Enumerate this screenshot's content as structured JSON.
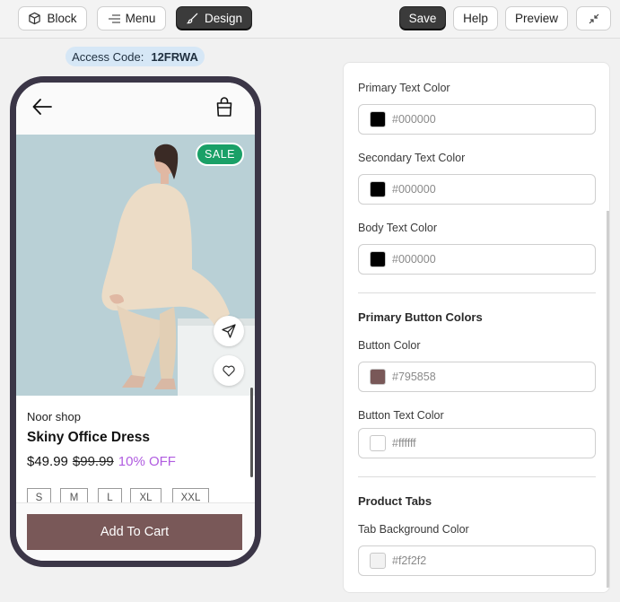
{
  "toolbar": {
    "block": "Block",
    "menu": "Menu",
    "design": "Design",
    "save": "Save",
    "help": "Help",
    "preview": "Preview"
  },
  "access": {
    "label": "Access Code:",
    "code": "12FRWA"
  },
  "product": {
    "badge": "SALE",
    "shop": "Noor shop",
    "title": "Skiny Office Dress",
    "price": "$49.99",
    "old_price": "$99.99",
    "discount": "10% OFF",
    "sizes": [
      "S",
      "M",
      "L",
      "XL",
      "XXL"
    ],
    "add_to_cart": "Add To Cart"
  },
  "panel": {
    "primary_text": {
      "label": "Primary Text Color",
      "value": "#000000",
      "color": "#000000"
    },
    "secondary_text": {
      "label": "Secondary Text Color",
      "value": "#000000",
      "color": "#000000"
    },
    "body_text": {
      "label": "Body Text Color",
      "value": "#000000",
      "color": "#000000"
    },
    "button_section": "Primary Button Colors",
    "button_color": {
      "label": "Button Color",
      "value": "#795858",
      "color": "#795858"
    },
    "button_text": {
      "label": "Button Text Color",
      "value": "#ffffff",
      "color": "#ffffff"
    },
    "tabs_section": "Product Tabs",
    "tab_bg": {
      "label": "Tab Background Color",
      "value": "#f2f2f2",
      "color": "#f2f2f2"
    }
  },
  "colors": {
    "accent_button": "#795858",
    "sale_badge": "#1aa067",
    "discount": "#b05ce0",
    "phone_frame": "#3b3647"
  }
}
